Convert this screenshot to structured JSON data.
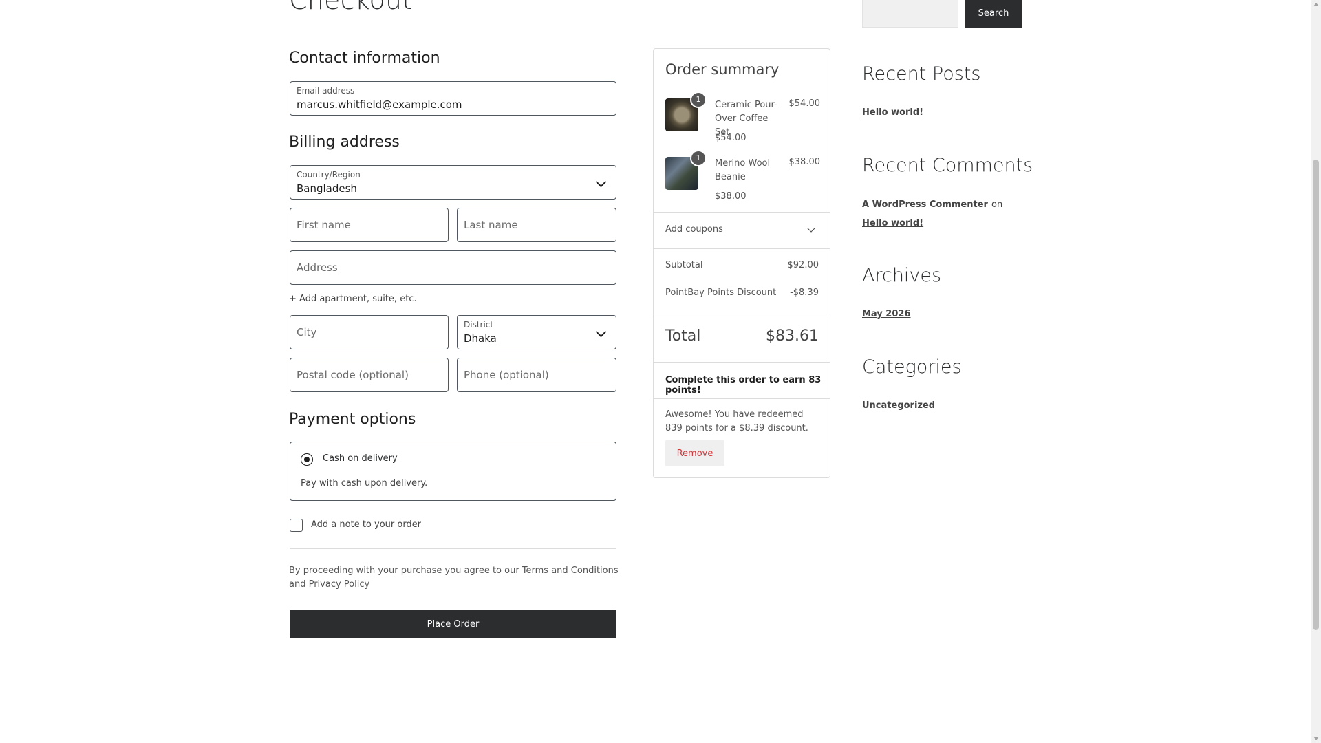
{
  "page": {
    "title": "Checkout"
  },
  "contact": {
    "heading": "Contact information",
    "email_label": "Email address",
    "email_value": "marcus.whitfield@example.com"
  },
  "billing": {
    "heading": "Billing address",
    "country_label": "Country/Region",
    "country_value": "Bangladesh",
    "first_name_placeholder": "First name",
    "last_name_placeholder": "Last name",
    "address_placeholder": "Address",
    "add_apartment": "+ Add apartment, suite, etc.",
    "city_placeholder": "City",
    "district_label": "District",
    "district_value": "Dhaka",
    "postal_placeholder": "Postal code (optional)",
    "phone_placeholder": "Phone (optional)"
  },
  "payment": {
    "heading": "Payment options",
    "method_label": "Cash on delivery",
    "method_description": "Pay with cash upon delivery.",
    "selected": true
  },
  "order_note": {
    "label": "Add a note to your order",
    "checked": false
  },
  "terms": "By proceeding with your purchase you agree to our Terms and Conditions and Privacy Policy",
  "place_order_label": "Place Order",
  "summary": {
    "heading": "Order summary",
    "items": [
      {
        "name": "Ceramic Pour-Over Coffee Set",
        "quantity": "1",
        "unit_price": "$54.00",
        "line_total": "$54.00",
        "thumbnail_icon": "coffee-set-thumbnail"
      },
      {
        "name": "Merino Wool Beanie",
        "quantity": "1",
        "unit_price": "$38.00",
        "line_total": "$38.00",
        "thumbnail_icon": "beanie-thumbnail"
      }
    ],
    "coupons_label": "Add coupons",
    "subtotal_label": "Subtotal",
    "subtotal_value": "$92.00",
    "discount_label": "PointBay Points Discount",
    "discount_value": "-$8.39",
    "total_label": "Total",
    "total_value": "$83.61",
    "earn_message": "Complete this order to earn 83 points!",
    "redeem_message": "Awesome! You have redeemed 839 points for a $8.39 discount.",
    "remove_label": "Remove"
  },
  "sidebar": {
    "search_button": "Search",
    "recent_posts_heading": "Recent Posts",
    "recent_posts": [
      "Hello world!"
    ],
    "recent_comments_heading": "Recent Comments",
    "comment_author": "A WordPress Commenter",
    "comment_on": "on",
    "comment_post": "Hello world!",
    "archives_heading": "Archives",
    "archives": [
      "May 2026"
    ],
    "categories_heading": "Categories",
    "categories": [
      "Uncategorized"
    ]
  },
  "colors": {
    "button_dark": "#2b2d2f",
    "remove_red": "#d63638",
    "border": "#50575e"
  }
}
